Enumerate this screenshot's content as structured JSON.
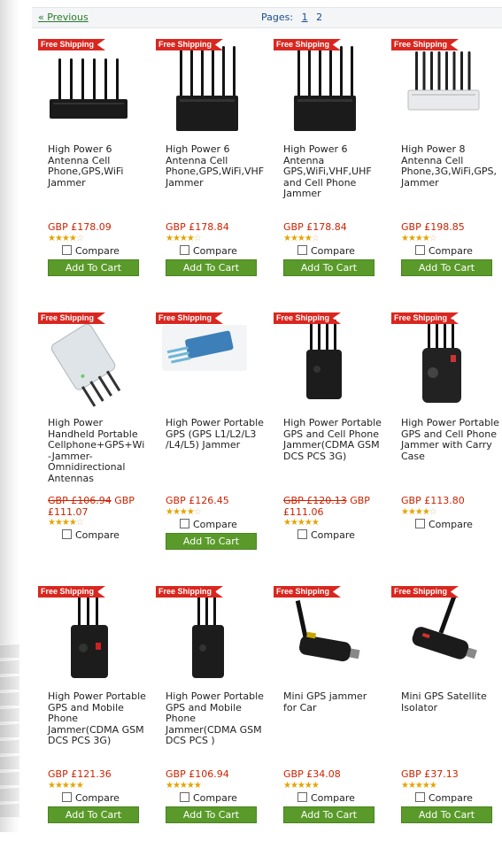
{
  "pager": {
    "previous": "« Previous",
    "pages_label": "Pages:",
    "pages": [
      "1",
      "2"
    ]
  },
  "labels": {
    "free_shipping": "Free Shipping",
    "compare": "Compare",
    "add_to_cart": "Add To Cart"
  },
  "colors": {
    "price": "#cc2200",
    "button": "#5a9a2a",
    "tag": "#d9271f",
    "star": "#e3a400"
  },
  "products": [
    {
      "name": "High Power 6 Antenna Cell Phone,GPS,WiFi Jammer",
      "old_price": "",
      "price": "GBP £178.09",
      "rating": 4,
      "image": "black-6-antenna-desktop-jammer",
      "has_cart": true
    },
    {
      "name": "High Power 6 Antenna Cell Phone,GPS,WiFi,VHF Jammer",
      "old_price": "",
      "price": "GBP £178.84",
      "rating": 4,
      "image": "black-6-antenna-tower-jammer",
      "has_cart": true
    },
    {
      "name": "High Power 6 Antenna GPS,WiFi,VHF,UHF and Cell Phone Jammer",
      "old_price": "",
      "price": "GBP £178.84",
      "rating": 4,
      "image": "black-6-antenna-tower-jammer",
      "has_cart": true
    },
    {
      "name": "High Power 8 Antenna Cell Phone,3G,WiFi,GPS, Jammer",
      "old_price": "",
      "price": "GBP £198.85",
      "rating": 4,
      "image": "white-8-antenna-jammer",
      "has_cart": true
    },
    {
      "name": "High Power Handheld Portable Cellphone+GPS+Wi-Jammer-Omnidirectional Antennas",
      "old_price": "GBP £106.94",
      "price": "GBP £111.07",
      "rating": 4,
      "image": "silver-handheld-jammer",
      "has_cart": false
    },
    {
      "name": "High Power Portable GPS (GPS L1/L2/L3 /L4/L5) Jammer",
      "old_price": "",
      "price": "GBP £126.45",
      "rating": 4,
      "image": "blue-portable-gps-jammer",
      "has_cart": true
    },
    {
      "name": "High Power Portable GPS and Cell Phone Jammer(CDMA GSM DCS PCS 3G)",
      "old_price": "GBP £120.13",
      "price": "GBP £111.06",
      "rating": 5,
      "image": "black-portable-4-antenna-jammer",
      "has_cart": false
    },
    {
      "name": "High Power Portable GPS and Cell Phone Jammer with Carry Case",
      "old_price": "",
      "price": "GBP £113.80",
      "rating": 4,
      "image": "black-jammer-carry-case",
      "has_cart": false
    },
    {
      "name": "High Power Portable GPS and Mobile Phone Jammer(CDMA GSM DCS PCS 3G)",
      "old_price": "",
      "price": "GBP £121.36",
      "rating": 5,
      "image": "black-portable-3-antenna-jammer",
      "has_cart": true
    },
    {
      "name": "High Power Portable GPS and Mobile Phone Jammer(CDMA GSM DCS PCS )",
      "old_price": "",
      "price": "GBP £106.94",
      "rating": 5,
      "image": "black-portable-3-antenna-jammer-slim",
      "has_cart": true
    },
    {
      "name": "Mini GPS jammer for Car",
      "old_price": "",
      "price": "GBP £34.08",
      "rating": 5,
      "image": "car-lighter-gps-jammer",
      "has_cart": true
    },
    {
      "name": "Mini GPS Satellite Isolator",
      "old_price": "",
      "price": "GBP £37.13",
      "rating": 5,
      "image": "car-lighter-gps-isolator",
      "has_cart": true
    }
  ]
}
